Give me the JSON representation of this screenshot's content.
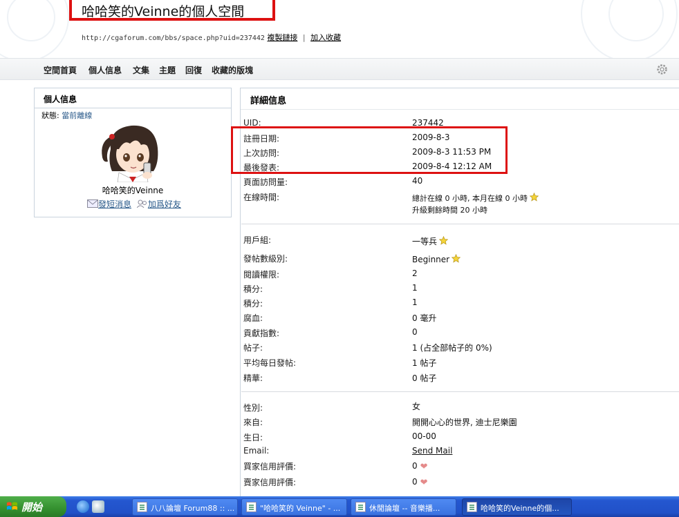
{
  "header": {
    "title": "哈哈笑的Veinne的個人空間",
    "url": "http://cgaforum.com/bbs/space.php?uid=237442",
    "copy_link": "複製鏈接",
    "separator": "|",
    "add_favorite": "加入收藏"
  },
  "nav": {
    "items": [
      "空間首頁",
      "個人信息",
      "文集",
      "主題",
      "回復",
      "收藏的版塊"
    ],
    "settings_icon": "gear-icon"
  },
  "profile": {
    "heading": "個人信息",
    "status_label": "狀態:",
    "status_value": "當前離線",
    "username": "哈哈笑的Veinne",
    "send_message": "發短消息",
    "add_friend": "加爲好友"
  },
  "details": {
    "heading": "詳細信息",
    "group1": [
      {
        "label": "UID:",
        "value": "237442"
      },
      {
        "label": "註冊日期:",
        "value": "2009-8-3"
      },
      {
        "label": "上次訪問:",
        "value": "2009-8-3 11:53 PM"
      },
      {
        "label": "最後發表:",
        "value": "2009-8-4 12:12 AM"
      },
      {
        "label": "頁面訪問量:",
        "value": "40"
      },
      {
        "label": "在線時間:",
        "value": "總計在線 0 小時, 本月在線 0 小時",
        "value2": "升級剩餘時間 20 小時"
      }
    ],
    "group2": [
      {
        "label": "用戶組:",
        "value": "一等兵"
      },
      {
        "label": "發帖數級別:",
        "value": "Beginner"
      },
      {
        "label": "閱讀權限:",
        "value": "2"
      },
      {
        "label": "積分:",
        "value": "1"
      },
      {
        "label": "積分:",
        "value": "1"
      },
      {
        "label": "腐血:",
        "value": "0 毫升"
      },
      {
        "label": "貢獻指數:",
        "value": "0"
      },
      {
        "label": "帖子:",
        "value": "1 (占全部帖子的 0%)"
      },
      {
        "label": "平均每日發帖:",
        "value": "1 帖子"
      },
      {
        "label": "精華:",
        "value": "0 帖子"
      }
    ],
    "group3": [
      {
        "label": "性別:",
        "value": "女"
      },
      {
        "label": "來自:",
        "value": "開開心心的世界, 迪士尼樂園"
      },
      {
        "label": "生日:",
        "value": "00-00"
      },
      {
        "label": "Email:",
        "value": "Send Mail"
      },
      {
        "label": "買家信用評價:",
        "value": "0"
      },
      {
        "label": "賣家信用評價:",
        "value": "0"
      }
    ]
  },
  "taskbar": {
    "start_label": "開始",
    "tasks": [
      "八八論壇 Forum88 :: ...",
      "\"哈哈笑的 Veinne\" - ...",
      "休閒論壇 -- 音樂播...",
      "哈哈笑的Veinne的個..."
    ]
  }
}
